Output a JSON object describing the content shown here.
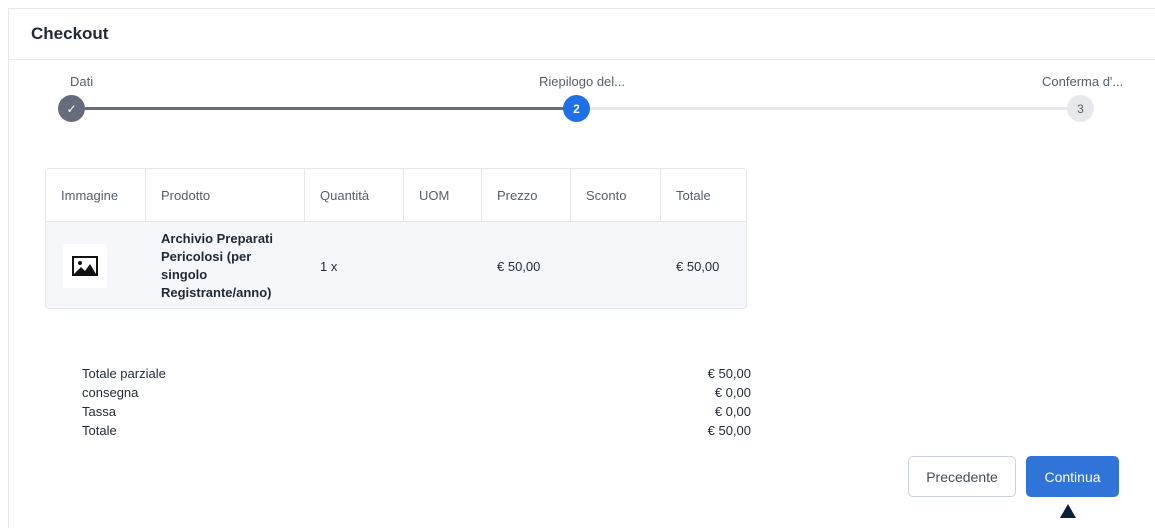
{
  "card": {
    "title": "Checkout"
  },
  "stepper": {
    "steps": [
      {
        "label": "Dati",
        "number": "✓",
        "state": "done"
      },
      {
        "label": "Riepilogo del...",
        "number": "2",
        "state": "active"
      },
      {
        "label": "Conferma d'...",
        "number": "3",
        "state": "todo"
      }
    ]
  },
  "table": {
    "headers": [
      "Immagine",
      "Prodotto",
      "Quantità",
      "UOM",
      "Prezzo",
      "Sconto",
      "Totale"
    ],
    "rows": [
      {
        "image_icon": "image-placeholder-icon",
        "product": "Archivio Preparati Pericolosi (per singolo Registrante/anno)",
        "quantity": "1 x",
        "uom": "",
        "price": "€ 50,00",
        "discount": "",
        "total": "€ 50,00"
      }
    ]
  },
  "summary": {
    "subtotal_label": "Totale parziale",
    "subtotal_value": "€ 50,00",
    "delivery_label": "consegna",
    "delivery_value": "€ 0,00",
    "tax_label": "Tassa",
    "tax_value": "€ 0,00",
    "total_label": "Totale",
    "total_value": "€ 50,00"
  },
  "buttons": {
    "previous": "Precedente",
    "continue": "Continua"
  },
  "colors": {
    "accent": "#2f74d6",
    "step_active": "#1f6fe5",
    "step_done": "#676c7c"
  }
}
